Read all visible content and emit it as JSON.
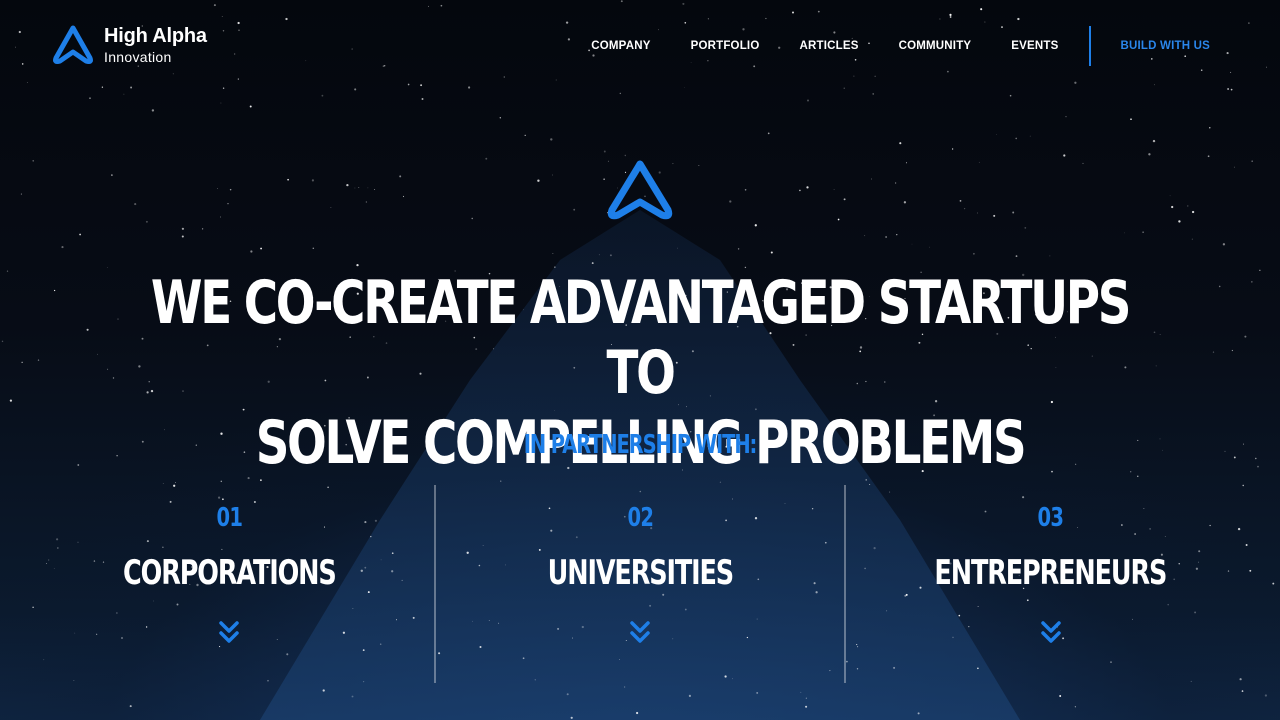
{
  "brand": {
    "line1": "High Alpha",
    "line2": "Innovation",
    "accent": "#1e7fe8"
  },
  "nav": {
    "items": [
      "COMPANY",
      "PORTFOLIO",
      "ARTICLES",
      "COMMUNITY",
      "EVENTS"
    ],
    "cta": "BUILD WITH US"
  },
  "hero": {
    "headline_line1": "WE CO-CREATE ADVANTAGED STARTUPS TO",
    "headline_line2": "SOLVE COMPELLING PROBLEMS",
    "partner_label": "IN PARTNERSHIP WITH:"
  },
  "columns": [
    {
      "num": "01",
      "title": "CORPORATIONS",
      "icon": "double-chevron-down-icon"
    },
    {
      "num": "02",
      "title": "UNIVERSITIES",
      "icon": "double-chevron-down-icon"
    },
    {
      "num": "03",
      "title": "ENTREPRENEURS",
      "icon": "double-chevron-down-icon"
    }
  ]
}
